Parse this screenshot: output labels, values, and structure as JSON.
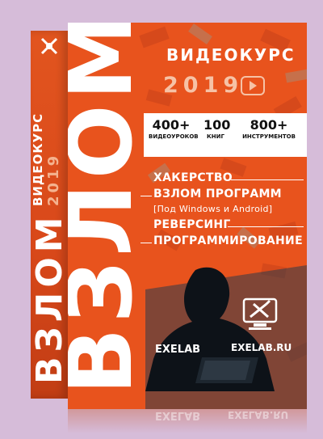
{
  "spine": {
    "title": "ВЗЛОМ",
    "subtitle": "ВИДЕОКУРС",
    "year": "2019"
  },
  "front": {
    "big_title": "ВЗЛОМ",
    "course_label": "ВИДЕОКУРС",
    "year": "2019",
    "stats": [
      {
        "value": "400+",
        "label": "ВИДЕОУРОКОВ"
      },
      {
        "value": "100",
        "label": "КНИГ"
      },
      {
        "value": "800+",
        "label": "ИНСТРУМЕНТОВ"
      }
    ],
    "topics": [
      "ХАКЕРСТВО",
      "ВЗЛОМ ПРОГРАММ",
      "[Под Windows и Android]",
      "РЕВЕРСИНГ",
      "ПРОГРАММИРОВАНИЕ"
    ],
    "brand": "EXELAB",
    "site": "EXELAB.RU"
  },
  "colors": {
    "background": "#d6bcd9",
    "box_orange": "#e8531d",
    "spine_orange": "#d8481a",
    "accent_peach": "#f6c2a6",
    "dark_overlay": "#2a3a4a"
  },
  "icons": [
    "youtube-play-icon",
    "tools-shield-icon",
    "exelab-logo-icon"
  ]
}
